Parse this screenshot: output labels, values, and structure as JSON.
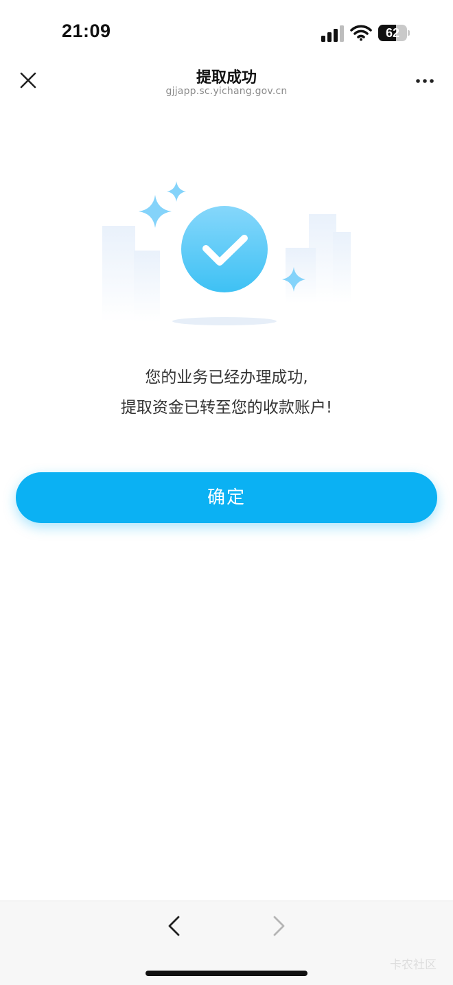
{
  "status_bar": {
    "time": "21:09",
    "battery_level": "62",
    "battery_fraction": 0.62,
    "icons": [
      "signal-icon",
      "wifi-icon",
      "battery-icon"
    ]
  },
  "navbar": {
    "title": "提取成功",
    "subtitle": "gjjapp.sc.yichang.gov.cn",
    "close_icon": "close-icon",
    "more_icon": "more-icon"
  },
  "illustration": {
    "icon": "success-check-icon",
    "accent_color": "#4cc4f5"
  },
  "message": {
    "line1": "您的业务已经办理成功,",
    "line2": "提取资金已转至您的收款账户!"
  },
  "confirm_button": {
    "label": "确定",
    "color": "#0bb1f3"
  },
  "bottom_bar": {
    "back_icon": "chevron-left-icon",
    "forward_icon": "chevron-right-icon",
    "watermark": "卡农社区"
  }
}
